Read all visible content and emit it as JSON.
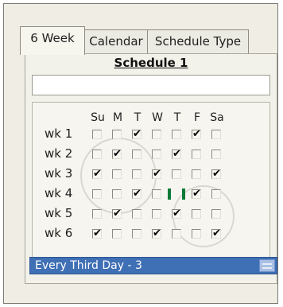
{
  "tabs": [
    {
      "label": "6 Week",
      "active": true
    },
    {
      "label": "Calendar",
      "active": false
    },
    {
      "label": "Schedule Type",
      "active": false
    }
  ],
  "schedule": {
    "title": "Schedule 1",
    "name_value": ""
  },
  "grid": {
    "day_headers": [
      "Su",
      "M",
      "T",
      "W",
      "T",
      "F",
      "Sa"
    ],
    "weeks": [
      {
        "label": "wk 1",
        "checked": [
          false,
          false,
          true,
          false,
          false,
          true,
          false
        ]
      },
      {
        "label": "wk 2",
        "checked": [
          false,
          true,
          false,
          false,
          true,
          false,
          false
        ]
      },
      {
        "label": "wk 3",
        "checked": [
          true,
          false,
          false,
          true,
          false,
          false,
          true
        ]
      },
      {
        "label": "wk 4",
        "checked": [
          false,
          false,
          true,
          false,
          false,
          true,
          false
        ]
      },
      {
        "label": "wk 5",
        "checked": [
          false,
          true,
          false,
          false,
          true,
          false,
          false
        ]
      },
      {
        "label": "wk 6",
        "checked": [
          true,
          false,
          false,
          true,
          false,
          false,
          true
        ]
      }
    ]
  },
  "schedule_type": {
    "selected": "Every Third Day - 3"
  },
  "colors": {
    "selection": "#3f6fb4",
    "focus": "#0b7a36"
  }
}
